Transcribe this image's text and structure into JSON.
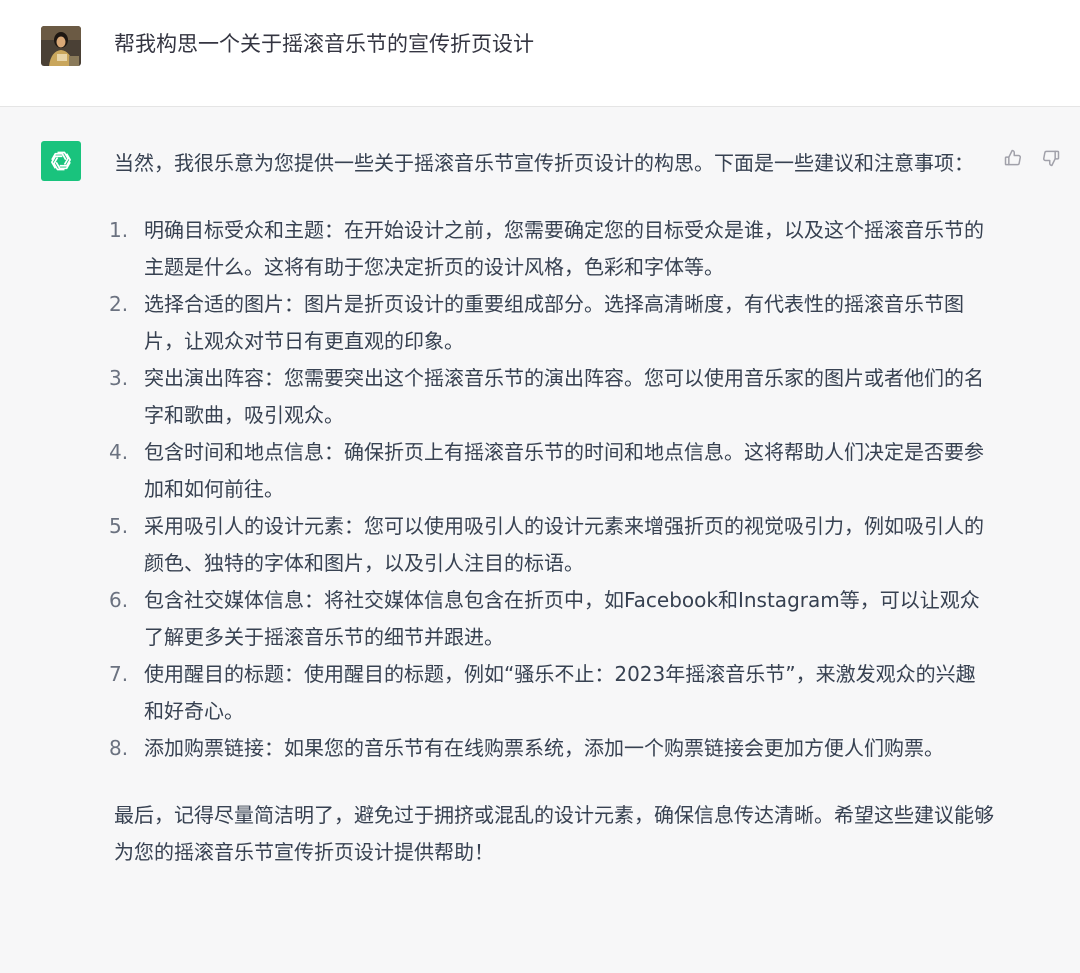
{
  "user_message": {
    "text": "帮我构思一个关于摇滚音乐节的宣传折页设计"
  },
  "assistant_message": {
    "intro": "当然，我很乐意为您提供一些关于摇滚音乐节宣传折页设计的构思。下面是一些建议和注意事项：",
    "items": [
      {
        "num": "1.",
        "text": "明确目标受众和主题：在开始设计之前，您需要确定您的目标受众是谁，以及这个摇滚音乐节的主题是什么。这将有助于您决定折页的设计风格，色彩和字体等。"
      },
      {
        "num": "2.",
        "text": "选择合适的图片：图片是折页设计的重要组成部分。选择高清晰度，有代表性的摇滚音乐节图片，让观众对节日有更直观的印象。"
      },
      {
        "num": "3.",
        "text": "突出演出阵容：您需要突出这个摇滚音乐节的演出阵容。您可以使用音乐家的图片或者他们的名字和歌曲，吸引观众。"
      },
      {
        "num": "4.",
        "text": "包含时间和地点信息：确保折页上有摇滚音乐节的时间和地点信息。这将帮助人们决定是否要参加和如何前往。"
      },
      {
        "num": "5.",
        "text": "采用吸引人的设计元素：您可以使用吸引人的设计元素来增强折页的视觉吸引力，例如吸引人的颜色、独特的字体和图片，以及引人注目的标语。"
      },
      {
        "num": "6.",
        "text": "包含社交媒体信息：将社交媒体信息包含在折页中，如Facebook和Instagram等，可以让观众了解更多关于摇滚音乐节的细节并跟进。"
      },
      {
        "num": "7.",
        "text": "使用醒目的标题：使用醒目的标题，例如“骚乐不止：2023年摇滚音乐节”，来激发观众的兴趣和好奇心。"
      },
      {
        "num": "8.",
        "text": "添加购票链接：如果您的音乐节有在线购票系统，添加一个购票链接会更加方便人们购票。"
      }
    ],
    "conclusion": "最后，记得尽量简洁明了，避免过于拥挤或混乱的设计元素，确保信息传达清晰。希望这些建议能够为您的摇滚音乐节宣传折页设计提供帮助！"
  },
  "icons": {
    "user_avatar": "user-avatar",
    "assistant_logo": "openai-logo-icon",
    "thumbs_up": "thumbs-up-icon",
    "thumbs_down": "thumbs-down-icon"
  },
  "colors": {
    "page_background": "#f7f7f8",
    "user_row_background": "#ffffff",
    "assistant_logo_bg": "#19c37d",
    "text": "#374151",
    "list_number": "#6b7280",
    "feedback_icon": "#a1a1aa"
  }
}
